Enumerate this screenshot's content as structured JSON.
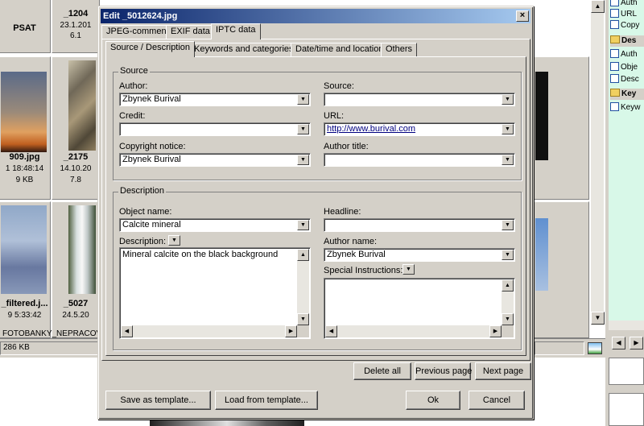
{
  "background": {
    "tiles": [
      {
        "name": "PSAT",
        "date": "",
        "size": ""
      },
      {
        "name": "_1204",
        "date": "23.1.201",
        "size": "6.1"
      },
      {
        "name": "909.jpg",
        "date": "1 18:48:14",
        "size": "9 KB"
      },
      {
        "name": "_2175",
        "date": "14.10.20",
        "size": "7.8"
      },
      {
        "name": "_filtered.j...",
        "date": "9 5:33:42",
        "size": ""
      },
      {
        "name": "_5027",
        "date": "24.5.20",
        "size": ""
      }
    ],
    "status_path": "FOTOBANKY_NEPRACOVA",
    "status_size": "286 KB",
    "tree_items": [
      {
        "label": "Auth",
        "kind": "item"
      },
      {
        "label": "URL",
        "kind": "item"
      },
      {
        "label": "Copy",
        "kind": "item"
      },
      {
        "label": "Des",
        "kind": "folder"
      },
      {
        "label": "Auth",
        "kind": "item"
      },
      {
        "label": "Obje",
        "kind": "item"
      },
      {
        "label": "Desc",
        "kind": "item"
      },
      {
        "label": "Key",
        "kind": "folder"
      },
      {
        "label": "Keyw",
        "kind": "item"
      }
    ]
  },
  "dialog": {
    "title": "Edit _5012624.jpg",
    "close": "×",
    "outer_tabs": [
      "JPEG-comment",
      "EXIF data",
      "IPTC data"
    ],
    "inner_tabs": [
      "Source / Description",
      "Keywords and categories",
      "Date/time and location",
      "Others"
    ],
    "source": {
      "title": "Source",
      "author_label": "Author:",
      "author_value": "Zbynek Burival",
      "source_label": "Source:",
      "source_value": "",
      "credit_label": "Credit:",
      "credit_value": "",
      "url_label": "URL:",
      "url_value": "http://www.burival.com",
      "copyright_label": "Copyright notice:",
      "copyright_value": "Zbynek Burival",
      "author_title_label": "Author title:",
      "author_title_value": ""
    },
    "description": {
      "title": "Description",
      "object_name_label": "Object name:",
      "object_name_value": "Calcite mineral",
      "headline_label": "Headline:",
      "headline_value": "",
      "description_label": "Description:",
      "description_value": "Mineral calcite on the black background",
      "author_name_label": "Author name:",
      "author_name_value": "Zbynek Burival",
      "special_label": "Special Instructions:",
      "special_value": ""
    },
    "buttons": {
      "delete_all": "Delete all",
      "previous_page": "Previous page",
      "next_page": "Next page",
      "save_template": "Save as template...",
      "load_template": "Load from template...",
      "ok": "Ok",
      "cancel": "Cancel"
    }
  },
  "colors": {
    "title_start": "#0a246a",
    "title_end": "#a6caf0",
    "face": "#d4d0c8",
    "tree_bg": "#d8f8e8",
    "url": "#000080"
  }
}
